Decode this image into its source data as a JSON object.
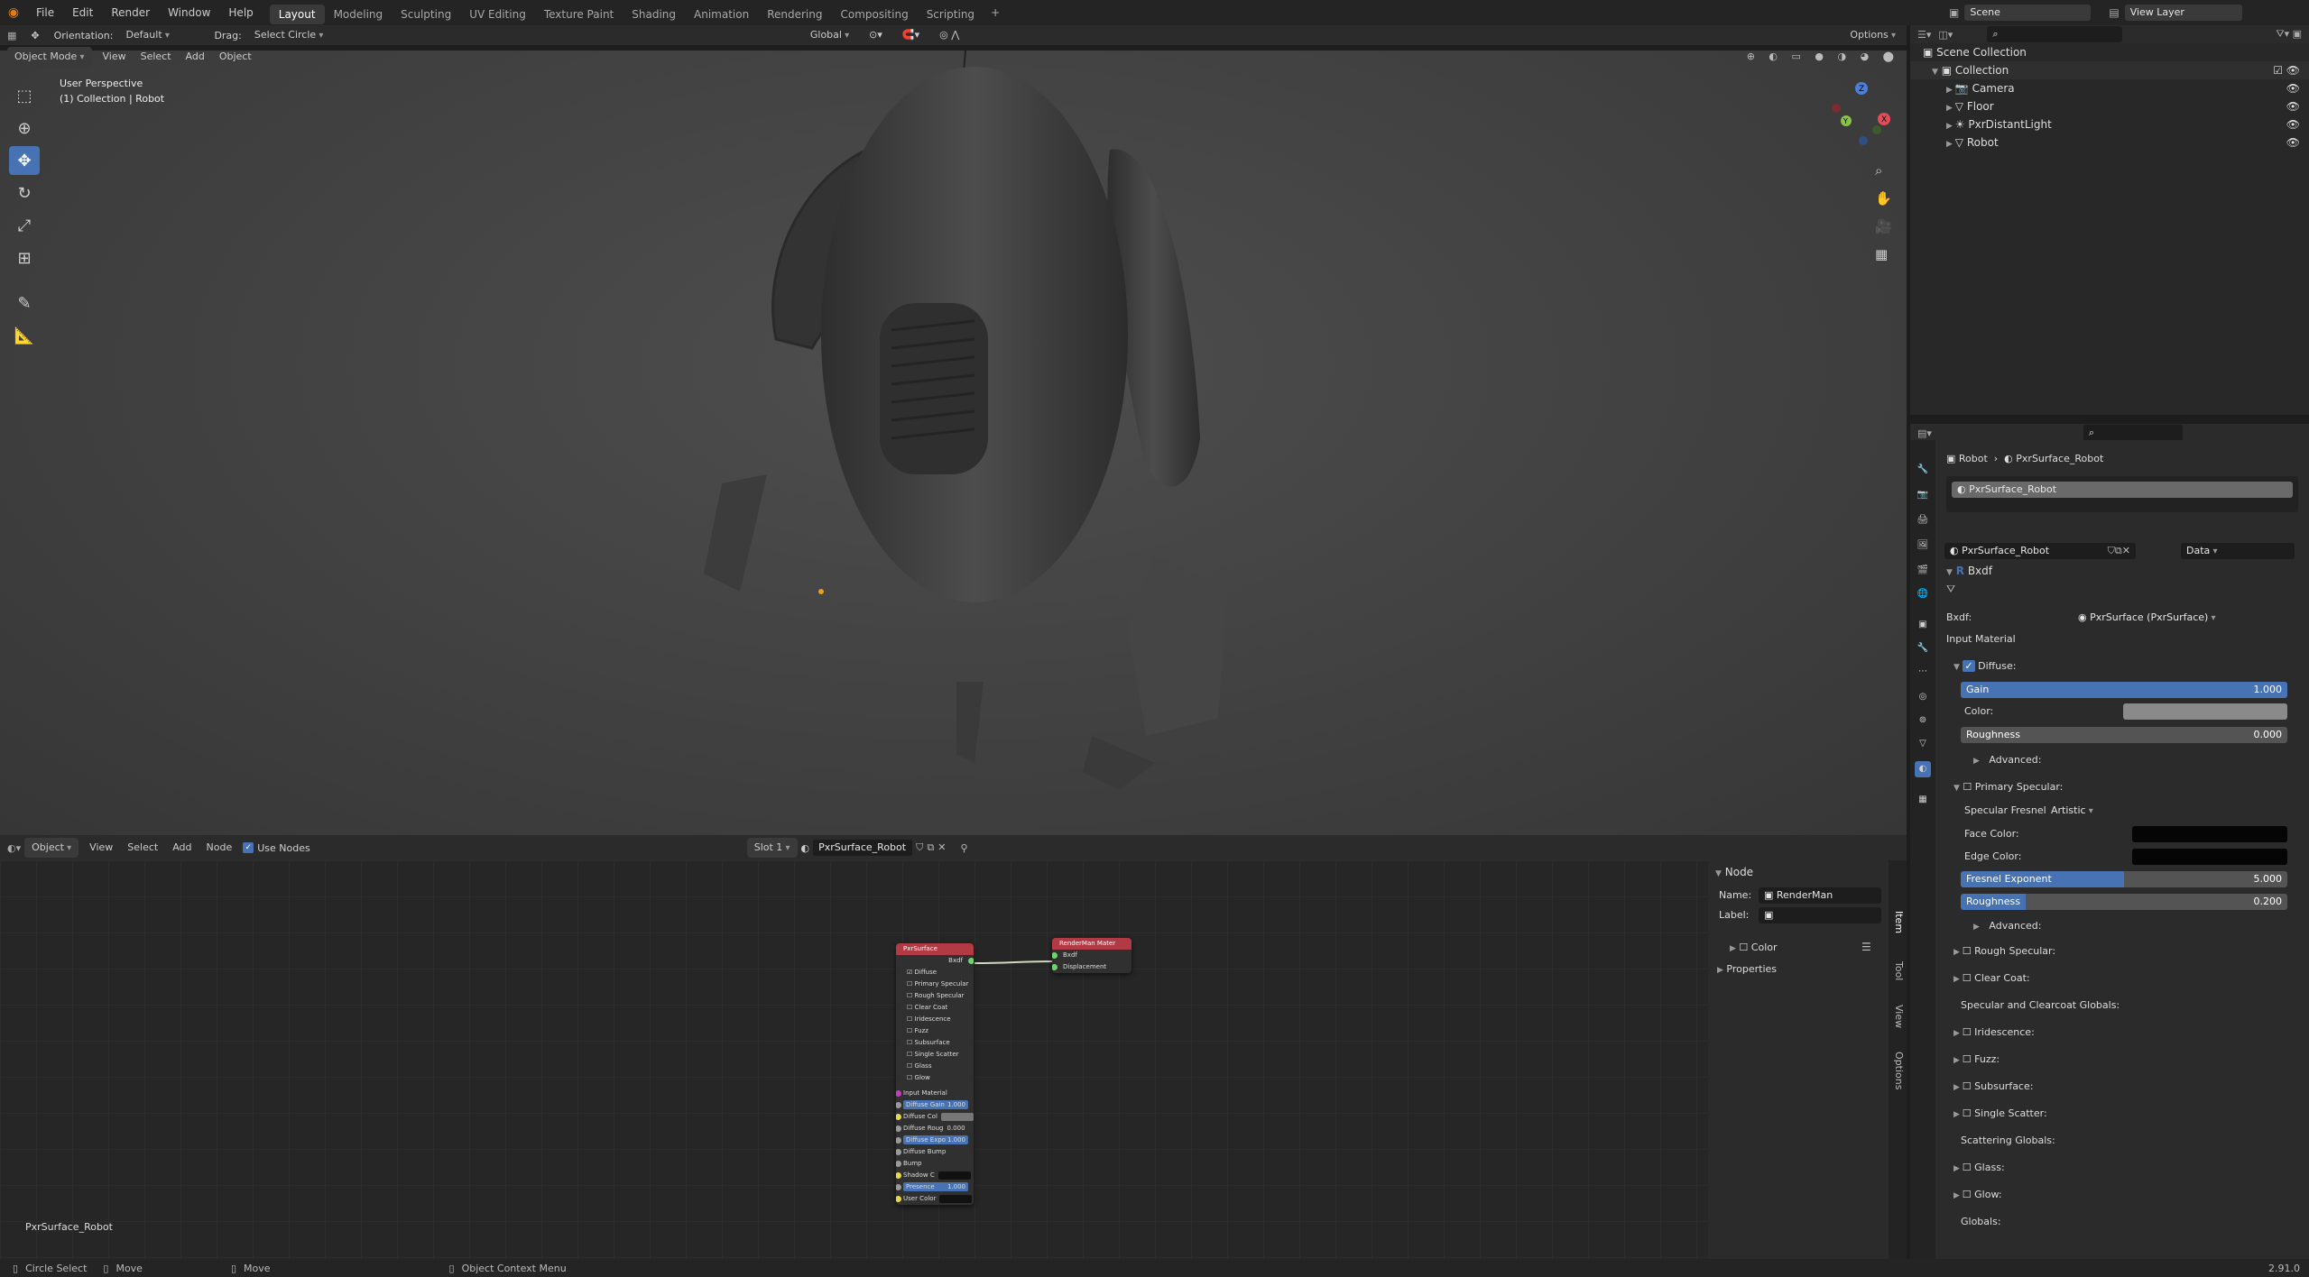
{
  "menus": [
    "File",
    "Edit",
    "Render",
    "Window",
    "Help"
  ],
  "workspaces": [
    "Layout",
    "Modeling",
    "Sculpting",
    "UV Editing",
    "Texture Paint",
    "Shading",
    "Animation",
    "Rendering",
    "Compositing",
    "Scripting"
  ],
  "topright": {
    "scene": "Scene",
    "view_layer": "View Layer"
  },
  "tool_header": {
    "orientation_label": "Orientation:",
    "orientation_value": "Default",
    "drag_label": "Drag:",
    "drag_value": "Select Circle",
    "transform": "Global",
    "options": "Options"
  },
  "viewport": {
    "mode": "Object Mode",
    "menus": [
      "View",
      "Select",
      "Add",
      "Object"
    ],
    "title": "User Perspective",
    "subtitle": "(1) Collection | Robot",
    "gizmo": {
      "x_color": "#e24b5a",
      "y_color": "#8bc34a",
      "z_color": "#4a7fdd"
    }
  },
  "tools": [
    "select-box-icon",
    "cursor-icon",
    "move-icon",
    "rotate-icon",
    "scale-icon",
    "transform-icon",
    "annotate-icon",
    "measure-icon"
  ],
  "outliner": {
    "root": "Scene Collection",
    "collection": "Collection",
    "items": [
      "Camera",
      "Floor",
      "PxrDistantLight",
      "Robot"
    ]
  },
  "node_header": {
    "type": "Object",
    "menus": [
      "View",
      "Select",
      "Add",
      "Node"
    ],
    "use_nodes": "Use Nodes",
    "slot": "Slot 1",
    "material": "PxrSurface_Robot"
  },
  "node_sidebar": {
    "title": "Node",
    "name_label": "Name:",
    "name_value": "RenderMan Material",
    "label_label": "Label:",
    "color": "Color",
    "properties": "Properties",
    "tabs": [
      "Item",
      "Tool",
      "View",
      "Options"
    ]
  },
  "nodes": {
    "pxr": {
      "title": "PxrSurface",
      "out": "Bxdf",
      "rows": [
        "Diffuse",
        "Primary Specular",
        "Rough Specular",
        "Clear Coat",
        "Iridescence",
        "Fuzz",
        "Subsurface",
        "Single Scatter",
        "Glass",
        "Glow"
      ],
      "inputs": [
        {
          "label": "Input Material"
        },
        {
          "label": "Diffuse Gain",
          "value": "1.000",
          "slider": true
        },
        {
          "label": "Diffuse Col",
          "color": true
        },
        {
          "label": "Diffuse Roug",
          "value": "0.000"
        },
        {
          "label": "Diffuse Expo",
          "value": "1.000",
          "slider": true
        },
        {
          "label": "Diffuse Bump"
        },
        {
          "label": "Bump"
        },
        {
          "label": "Shadow C",
          "color": true,
          "dark": true
        },
        {
          "label": "Presence",
          "value": "1.000",
          "slider": true
        },
        {
          "label": "User Color",
          "color": true,
          "dark": true
        }
      ]
    },
    "rman": {
      "title": "RenderMan Mater",
      "rows": [
        "Bxdf",
        "Displacement"
      ]
    }
  },
  "node_editor_footer": "PxrSurface_Robot",
  "properties": {
    "breadcrumb_object": "Robot",
    "breadcrumb_material": "PxrSurface_Robot",
    "slot_item": "PxrSurface_Robot",
    "material_name": "PxrSurface_Robot",
    "link": "Data",
    "bxdf_panel": "Bxdf",
    "bxdf_label": "Bxdf:",
    "bxdf_value": "PxrSurface (PxrSurface)",
    "input_material": "Input Material",
    "diffuse": "Diffuse:",
    "gain_label": "Gain",
    "gain_value": "1.000",
    "gain_fraction": 1.0,
    "color_label": "Color:",
    "roughness_label": "Roughness",
    "roughness_value": "0.000",
    "advanced": "Advanced:",
    "primary_specular": "Primary Specular:",
    "fresnel_label": "Specular Fresnel...",
    "fresnel_value": "Artistic",
    "face_color": "Face Color:",
    "edge_color": "Edge Color:",
    "fresnel_exp_label": "Fresnel Exponent",
    "fresnel_exp_value": "5.000",
    "fresnel_exp_fraction": 0.5,
    "spec_rough_label": "Roughness",
    "spec_rough_value": "0.200",
    "spec_rough_fraction": 0.2,
    "advanced2": "Advanced:",
    "sections": [
      "Rough Specular:",
      "Clear Coat:",
      "Specular and Clearcoat Globals:",
      "Iridescence:",
      "Fuzz:",
      "Subsurface:",
      "Single Scatter:",
      "Scattering Globals:",
      "Glass:",
      "Glow:",
      "Globals:"
    ]
  },
  "status": {
    "circle_select": "Circle Select",
    "move1": "Move",
    "move2": "Move",
    "context": "Object Context Menu",
    "version": "2.91.0"
  }
}
